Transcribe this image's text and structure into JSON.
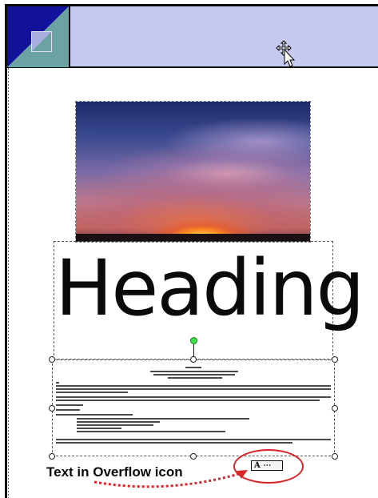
{
  "header": {
    "corner_icon": "document-corner-icon",
    "cursor_icon": "move-cursor-icon"
  },
  "picture": {
    "description_icon": "sunset-photo"
  },
  "heading_frame": {
    "text": "Heading"
  },
  "body_frame": {
    "selected": true,
    "rotate_handle_color": "#3ee04a"
  },
  "annotation": {
    "caption": "Text in Overflow icon",
    "overflow_icon_label": "A ⋯",
    "ring_color": "#d8262a",
    "arrow_color": "#d8262a"
  },
  "colors": {
    "band": "#c6c9f0",
    "corner": "#11119a",
    "corner_accent": "#6aa3a1"
  }
}
